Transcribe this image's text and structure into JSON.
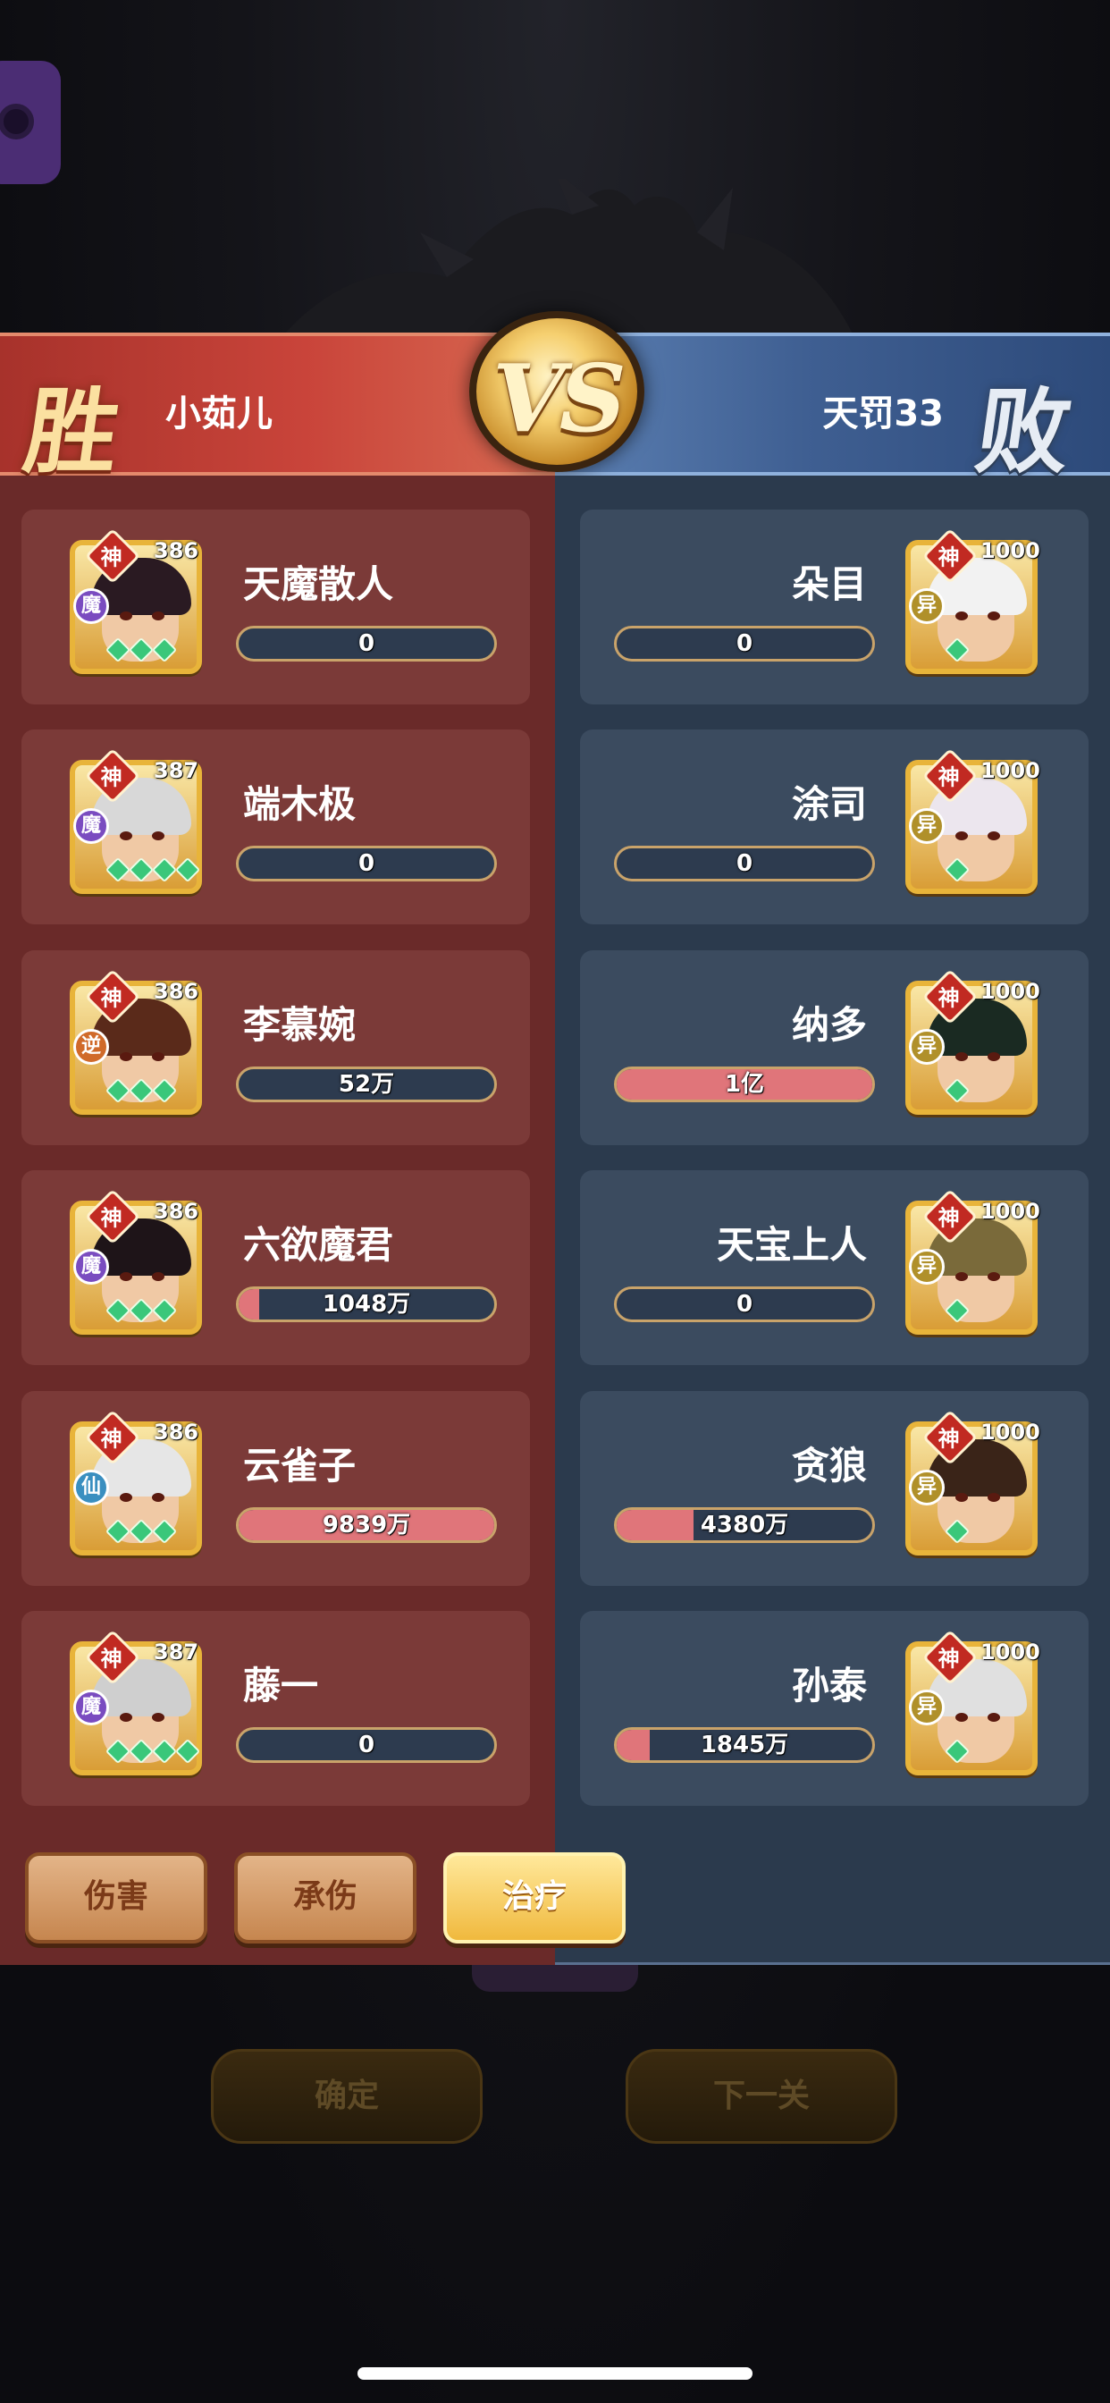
{
  "header": {
    "left_result": "胜",
    "left_player": "小茹儿",
    "vs": "VS",
    "right_player": "天罚33",
    "right_result": "败"
  },
  "colors": {
    "left_panel": "#6a2a29",
    "right_panel": "#2b3a4d",
    "bar_fill": "#e0757a",
    "tab_active": "#f0b93e"
  },
  "left_team": [
    {
      "name": "天魔散人",
      "level": "386",
      "rank": "神",
      "faction": "魔",
      "stars": 3,
      "value": "0",
      "fill": 0
    },
    {
      "name": "端木极",
      "level": "387",
      "rank": "神",
      "faction": "魔",
      "stars": 4,
      "value": "0",
      "fill": 0
    },
    {
      "name": "李慕婉",
      "level": "386",
      "rank": "神",
      "faction": "逆",
      "stars": 3,
      "value": "52万",
      "fill": 0
    },
    {
      "name": "六欲魔君",
      "level": "386",
      "rank": "神",
      "faction": "魔",
      "stars": 3,
      "value": "1048万",
      "fill": 0.08
    },
    {
      "name": "云雀子",
      "level": "386",
      "rank": "神",
      "faction": "仙",
      "stars": 3,
      "value": "9839万",
      "fill": 1.0
    },
    {
      "name": "藤一",
      "level": "387",
      "rank": "神",
      "faction": "魔",
      "stars": 4,
      "value": "0",
      "fill": 0
    }
  ],
  "right_team": [
    {
      "name": "朵目",
      "level": "1000",
      "rank": "神",
      "faction": "异",
      "stars": 1,
      "value": "0",
      "fill": 0
    },
    {
      "name": "涂司",
      "level": "1000",
      "rank": "神",
      "faction": "异",
      "stars": 1,
      "value": "0",
      "fill": 0
    },
    {
      "name": "纳多",
      "level": "1000",
      "rank": "神",
      "faction": "异",
      "stars": 1,
      "value": "1亿",
      "fill": 1.0
    },
    {
      "name": "天宝上人",
      "level": "1000",
      "rank": "神",
      "faction": "异",
      "stars": 1,
      "value": "0",
      "fill": 0
    },
    {
      "name": "贪狼",
      "level": "1000",
      "rank": "神",
      "faction": "异",
      "stars": 1,
      "value": "4380万",
      "fill": 0.3
    },
    {
      "name": "孙泰",
      "level": "1000",
      "rank": "神",
      "faction": "异",
      "stars": 1,
      "value": "1845万",
      "fill": 0.13
    }
  ],
  "tabs": [
    {
      "label": "伤害",
      "active": false
    },
    {
      "label": "承伤",
      "active": false
    },
    {
      "label": "治疗",
      "active": true
    }
  ],
  "footer": {
    "confirm_label": "确定",
    "next_label": "下一关"
  }
}
